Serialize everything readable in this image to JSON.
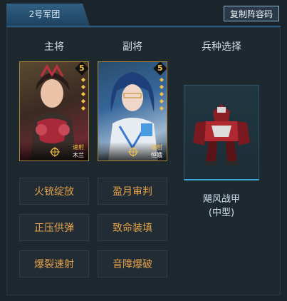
{
  "header": {
    "tab_label": "2号军团",
    "copy_button": "复制阵容码"
  },
  "columns": {
    "main": "主将",
    "vice": "副将",
    "troop": "兵种选择"
  },
  "cards": [
    {
      "star": "5",
      "type": "速射",
      "name": "木兰"
    },
    {
      "star": "5",
      "type": "速射",
      "name": "恒娥"
    }
  ],
  "unit": {
    "name_line1": "飓风战甲",
    "name_line2": "(中型)"
  },
  "skills": [
    [
      "火铳绽放",
      "盈月审判"
    ],
    [
      "正压供弹",
      "致命装填"
    ],
    [
      "爆裂速射",
      "音障爆破"
    ]
  ],
  "colors": {
    "accent": "#3ea9d8",
    "skill_text": "#e5a24a",
    "star_gold": "#f2c14a"
  }
}
